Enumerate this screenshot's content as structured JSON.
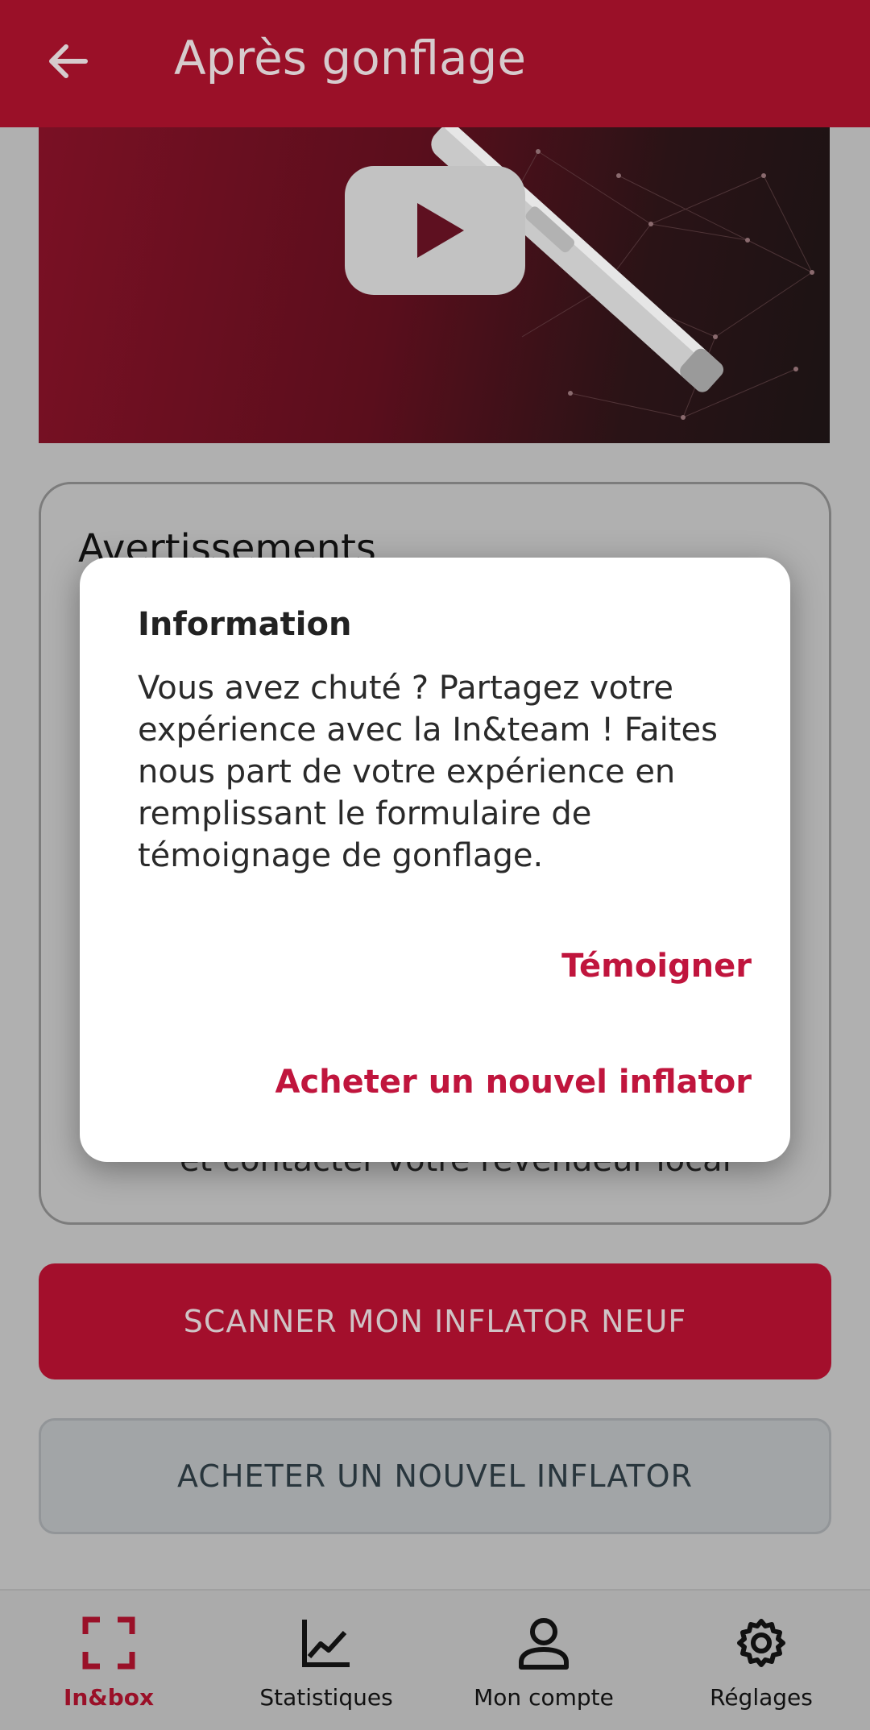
{
  "header": {
    "title": "Après gonflage",
    "back_icon": "arrow-left-icon"
  },
  "video": {
    "play_icon": "youtube-play-icon"
  },
  "warnings_card": {
    "title": "Avertissements",
    "partial_text": "et contacter votre revendeur local"
  },
  "buttons": {
    "scan_label": "SCANNER MON INFLATOR NEUF",
    "buy_label": "ACHETER UN NOUVEL INFLATOR"
  },
  "dialog": {
    "title": "Information",
    "message": "Vous avez chuté ? Partagez votre expérience avec la In&team ! Faites nous part de votre expérience en remplissant le formulaire de témoignage de gonflage.",
    "action_testify": "Témoigner",
    "action_buy": "Acheter un nouvel inflator"
  },
  "bottom_nav": {
    "items": [
      {
        "label": "In&box",
        "icon": "scan-frame-icon",
        "active": true
      },
      {
        "label": "Statistiques",
        "icon": "chart-line-icon",
        "active": false
      },
      {
        "label": "Mon compte",
        "icon": "user-icon",
        "active": false
      },
      {
        "label": "Réglages",
        "icon": "gear-icon",
        "active": false
      }
    ]
  },
  "colors": {
    "brand": "#9a1028",
    "accent": "#c0153d",
    "scrim": "#b0b0b0"
  }
}
